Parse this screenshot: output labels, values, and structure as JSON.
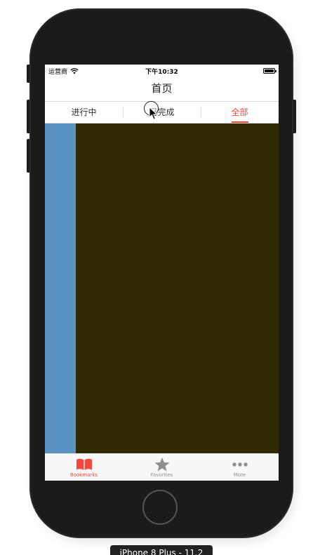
{
  "status_bar": {
    "carrier": "运营商",
    "time": "下午10:32"
  },
  "nav": {
    "title": "首页"
  },
  "segments": {
    "items": [
      {
        "label": "进行中"
      },
      {
        "label": "已完成"
      },
      {
        "label": "全部"
      }
    ],
    "selected": "全部"
  },
  "content": {
    "left_panel_color": "#5893c4",
    "main_panel_color": "#302a04"
  },
  "tab_bar": {
    "items": [
      {
        "label": "Bookmarks",
        "icon": "book-icon"
      },
      {
        "label": "Favorites",
        "icon": "star-icon"
      },
      {
        "label": "More",
        "icon": "more-dots-icon"
      }
    ],
    "selected": "Bookmarks"
  },
  "simulator": {
    "device_label": "iPhone 8 Plus - 11.2"
  },
  "colors": {
    "accent": "#f2493c",
    "inactive": "#8e8e93",
    "device_body": "#1b1b1b"
  }
}
